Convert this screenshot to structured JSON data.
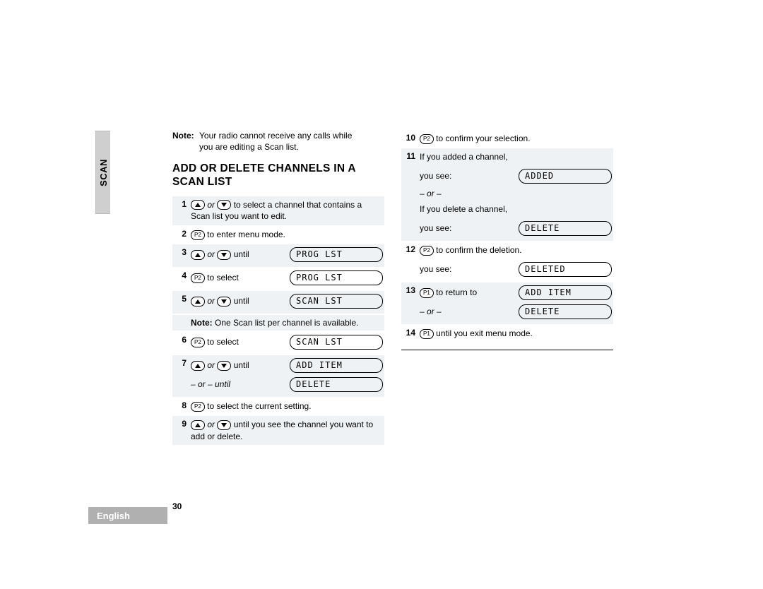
{
  "tab": "SCAN",
  "language": "English",
  "page_number": "30",
  "top_note_label": "Note:",
  "top_note_text": "Your radio cannot receive any calls while you are editing a Scan list.",
  "heading": "ADD OR DELETE CHANNELS IN A SCAN LIST",
  "or": "or",
  "or_dash": "– or –",
  "until": "until",
  "until_dash": "– or – until",
  "keys": {
    "p1": "P1",
    "p2": "P2"
  },
  "col1": {
    "s1": {
      "n": "1",
      "text_tail": "to select a channel that contains a Scan list you want to edit."
    },
    "s2": {
      "n": "2",
      "text": "to enter menu mode."
    },
    "s3": {
      "n": "3",
      "lcd": "PROG  LST"
    },
    "s4": {
      "n": "4",
      "text": "to select",
      "lcd": "PROG  LST"
    },
    "s5": {
      "n": "5",
      "lcd": "SCAN  LST"
    },
    "note_label": "Note:",
    "note_text": "One Scan list per channel is available.",
    "s6": {
      "n": "6",
      "text": "to select",
      "lcd": "SCAN  LST"
    },
    "s7": {
      "n": "7",
      "lcd1": "ADD  ITEM",
      "lcd2": "DELETE"
    },
    "s8": {
      "n": "8",
      "text": "to select the current setting."
    },
    "s9": {
      "n": "9",
      "text_tail": "until you see the channel you want to add or delete."
    }
  },
  "col2": {
    "s10": {
      "n": "10",
      "text": "to confirm your selection."
    },
    "s11": {
      "n": "11",
      "added_intro": "If you added a channel,",
      "you_see": "you see:",
      "lcd_added": "ADDED",
      "deleted_intro": "If you delete a channel,",
      "lcd_delete": "DELETE"
    },
    "s12": {
      "n": "12",
      "text": "to confirm the deletion.",
      "you_see": "you see:",
      "lcd": "DELETED"
    },
    "s13": {
      "n": "13",
      "text": "to return to",
      "lcd1": "ADD  ITEM",
      "lcd2": "DELETE"
    },
    "s14": {
      "n": "14",
      "text": "until you exit menu mode."
    }
  }
}
